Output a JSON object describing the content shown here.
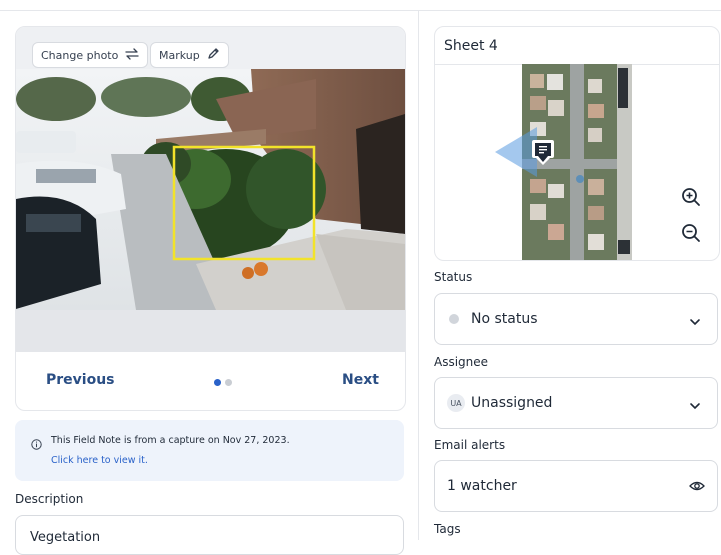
{
  "photo_card": {
    "change_photo_label": "Change photo",
    "markup_label": "Markup",
    "previous_label": "Previous",
    "next_label": "Next",
    "page_count": 2,
    "active_page": 1
  },
  "info": {
    "text": "This Field Note is from a capture on Nov 27, 2023.",
    "link": "Click here to view it."
  },
  "description": {
    "label": "Description",
    "value": "Vegetation"
  },
  "sheet": {
    "title": "Sheet 4"
  },
  "status": {
    "label": "Status",
    "value": "No status"
  },
  "assignee": {
    "label": "Assignee",
    "avatar": "UA",
    "value": "Unassigned"
  },
  "email_alerts": {
    "label": "Email alerts",
    "value": "1 watcher"
  },
  "tags": {
    "label": "Tags"
  },
  "colors": {
    "accent": "#2a4e84",
    "highlight_box": "#f2e32a",
    "info_bg": "#eef3fb"
  }
}
